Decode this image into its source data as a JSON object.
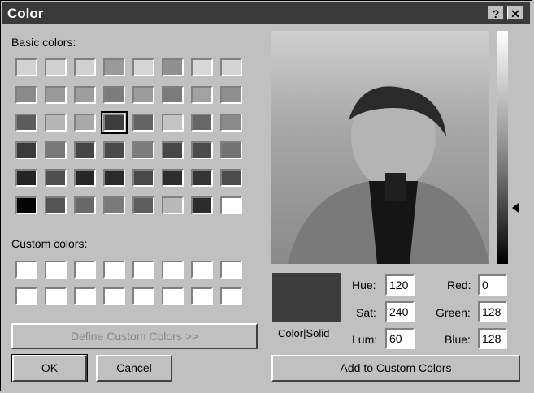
{
  "window": {
    "title": "Color",
    "help_icon": "?",
    "close_icon": "✕"
  },
  "labels": {
    "basic_colors": "Basic colors:",
    "custom_colors": "Custom colors:",
    "color_solid": "Color|Solid"
  },
  "basic_colors": [
    "#d3d3d3",
    "#cfcfcf",
    "#d1d1d1",
    "#9a9a9a",
    "#d6d6d6",
    "#8f8f8f",
    "#d8d8d8",
    "#d4d4d4",
    "#8a8a8a",
    "#999999",
    "#9e9e9e",
    "#7d7d7d",
    "#9c9c9c",
    "#7b7b7b",
    "#a2a2a2",
    "#8f8f8f",
    "#5c5c5c",
    "#b5b5b5",
    "#a9a9a9",
    "#3d3d3d",
    "#646464",
    "#c4c4c4",
    "#666666",
    "#8a8a8a",
    "#3a3a3a",
    "#787878",
    "#454545",
    "#4a4a4a",
    "#7c7c7c",
    "#474747",
    "#4c4c4c",
    "#727272",
    "#242424",
    "#505050",
    "#262626",
    "#2a2a2a",
    "#484848",
    "#2d2d2d",
    "#353535",
    "#4d4d4d",
    "#050505",
    "#555555",
    "#686868",
    "#7a7a7a",
    "#5e5e5e",
    "#b9b9b9",
    "#2c2c2c",
    "#ffffff"
  ],
  "selected_index": 19,
  "custom_colors": [
    "#ffffff",
    "#ffffff",
    "#ffffff",
    "#ffffff",
    "#ffffff",
    "#ffffff",
    "#ffffff",
    "#ffffff",
    "#ffffff",
    "#ffffff",
    "#ffffff",
    "#ffffff",
    "#ffffff",
    "#ffffff",
    "#ffffff",
    "#ffffff"
  ],
  "buttons": {
    "define": "Define Custom Colors >>",
    "ok": "OK",
    "cancel": "Cancel",
    "add": "Add to Custom Colors"
  },
  "fields": {
    "hue_label": "Hue:",
    "hue": "120",
    "sat_label": "Sat:",
    "sat": "240",
    "lum_label": "Lum:",
    "lum": "60",
    "red_label": "Red:",
    "red": "0",
    "green_label": "Green:",
    "green": "128",
    "blue_label": "Blue:",
    "blue": "128"
  },
  "current_color": "#3d3d3d"
}
